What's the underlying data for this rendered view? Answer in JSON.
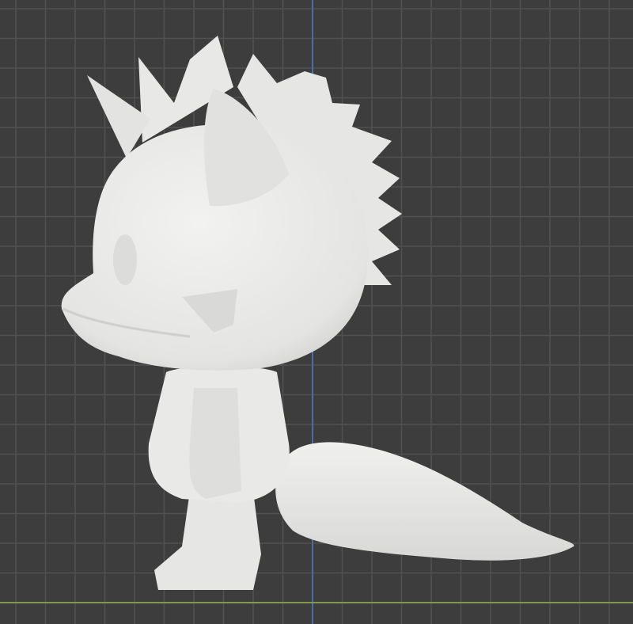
{
  "viewport": {
    "background_color": "#3d3d3d",
    "grid_color": "#515151",
    "axis_z_color": "#4a6ea0",
    "axis_x_color": "#7f9a4a",
    "model_color": "#ebebea",
    "model_shadow_color": "#d2d2d0"
  }
}
